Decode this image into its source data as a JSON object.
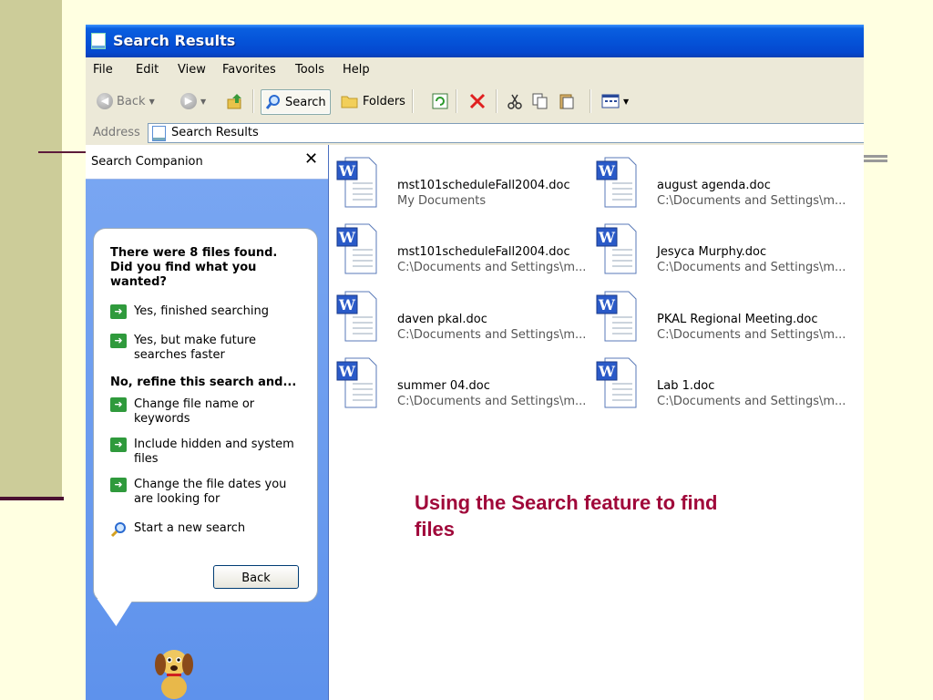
{
  "window": {
    "title": "Search Results"
  },
  "menu": [
    "File",
    "Edit",
    "View",
    "Favorites",
    "Tools",
    "Help"
  ],
  "toolbar": {
    "back_label": "Back",
    "search_label": "Search",
    "folders_label": "Folders"
  },
  "address": {
    "label": "Address",
    "value": "Search Results"
  },
  "companion": {
    "title": "Search Companion",
    "heading": "There were 8 files found. Did you find what you wanted?",
    "options_yes": [
      "Yes, finished searching",
      "Yes, but make future searches faster"
    ],
    "refine_heading": "No, refine this search and...",
    "options_refine": [
      "Change file name or keywords",
      "Include hidden and system files",
      "Change the file dates you are looking for"
    ],
    "new_search": "Start a new search",
    "back_button": "Back"
  },
  "files": [
    {
      "name": "mst101scheduleFall2004.doc",
      "path": "My Documents"
    },
    {
      "name": "august agenda.doc",
      "path": "C:\\Documents and Settings\\m..."
    },
    {
      "name": "mst101scheduleFall2004.doc",
      "path": "C:\\Documents and Settings\\m..."
    },
    {
      "name": "Jesyca Murphy.doc",
      "path": "C:\\Documents and Settings\\m..."
    },
    {
      "name": "daven pkal.doc",
      "path": "C:\\Documents and Settings\\m..."
    },
    {
      "name": "PKAL Regional Meeting.doc",
      "path": "C:\\Documents and Settings\\m..."
    },
    {
      "name": "summer 04.doc",
      "path": "C:\\Documents and Settings\\m..."
    },
    {
      "name": "Lab 1.doc",
      "path": "C:\\Documents and Settings\\m..."
    }
  ],
  "slide": {
    "caption": "Using the Search feature to find files"
  },
  "colors": {
    "titlebar": "#0553D8",
    "caption": "#A0083A",
    "companion_bg": "#6FA0F0"
  }
}
